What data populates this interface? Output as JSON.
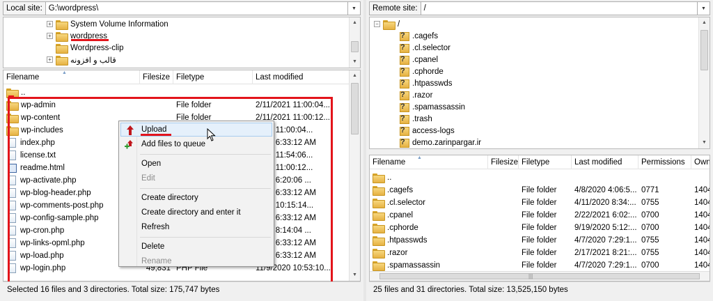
{
  "local": {
    "site_label": "Local site:",
    "site_path": "G:\\wordpress\\",
    "tree": [
      {
        "label": "System Volume Information"
      },
      {
        "label": "wordpress"
      },
      {
        "label": "Wordpress-clip"
      },
      {
        "label": "قالب و افزونه"
      }
    ],
    "columns": [
      "Filename",
      "Filesize",
      "Filetype",
      "Last modified"
    ],
    "files": [
      {
        "name": "..",
        "size": "",
        "type": "",
        "modified": "",
        "icon": "folder"
      },
      {
        "name": "wp-admin",
        "size": "",
        "type": "File folder",
        "modified": "2/11/2021 11:00:04...",
        "icon": "folder"
      },
      {
        "name": "wp-content",
        "size": "",
        "type": "File folder",
        "modified": "2/11/2021 11:00:12...",
        "icon": "folder"
      },
      {
        "name": "wp-includes",
        "size": "",
        "type": "",
        "modified": "2021 11:00:04...",
        "icon": "folder"
      },
      {
        "name": "index.php",
        "size": "",
        "type": "",
        "modified": "2020 6:33:12 AM",
        "icon": "file"
      },
      {
        "name": "license.txt",
        "size": "",
        "type": "",
        "modified": "2021 11:54:06...",
        "icon": "file"
      },
      {
        "name": "readme.html",
        "size": "",
        "type": "",
        "modified": "2021 11:00:12...",
        "icon": "html"
      },
      {
        "name": "wp-activate.php",
        "size": "",
        "type": "",
        "modified": "2020 6:20:06 ...",
        "icon": "file"
      },
      {
        "name": "wp-blog-header.php",
        "size": "",
        "type": "",
        "modified": "2020 6:33:12 AM",
        "icon": "file"
      },
      {
        "name": "wp-comments-post.php",
        "size": "",
        "type": "",
        "modified": "2020 10:15:14...",
        "icon": "file"
      },
      {
        "name": "wp-config-sample.php",
        "size": "",
        "type": "",
        "modified": "2020 6:33:12 AM",
        "icon": "file"
      },
      {
        "name": "wp-cron.php",
        "size": "",
        "type": "",
        "modified": "2020 8:14:04 ...",
        "icon": "file"
      },
      {
        "name": "wp-links-opml.php",
        "size": "",
        "type": "",
        "modified": "2020 6:33:12 AM",
        "icon": "file"
      },
      {
        "name": "wp-load.php",
        "size": "",
        "type": "",
        "modified": "2020 6:33:12 AM",
        "icon": "file"
      },
      {
        "name": "wp-login.php",
        "size": "49,831",
        "type": "PHP File",
        "modified": "11/9/2020 10:53:10...",
        "icon": "file"
      }
    ],
    "status": "Selected 16 files and 3 directories. Total size: 175,747 bytes"
  },
  "context_menu": {
    "items": [
      {
        "label": "Upload",
        "state": "hover",
        "icon": "upload-arrow-icon"
      },
      {
        "label": "Add files to queue",
        "state": "normal",
        "icon": "add-to-queue-icon"
      },
      {
        "sep": true
      },
      {
        "label": "Open",
        "state": "normal"
      },
      {
        "label": "Edit",
        "state": "disabled"
      },
      {
        "sep": true
      },
      {
        "label": "Create directory",
        "state": "normal"
      },
      {
        "label": "Create directory and enter it",
        "state": "normal"
      },
      {
        "label": "Refresh",
        "state": "normal"
      },
      {
        "sep": true
      },
      {
        "label": "Delete",
        "state": "normal"
      },
      {
        "label": "Rename",
        "state": "disabled"
      }
    ]
  },
  "remote": {
    "site_label": "Remote site:",
    "site_path": "/",
    "tree_root": "/",
    "tree": [
      {
        "label": ".cagefs"
      },
      {
        "label": ".cl.selector"
      },
      {
        "label": ".cpanel"
      },
      {
        "label": ".cphorde"
      },
      {
        "label": ".htpasswds"
      },
      {
        "label": ".razor"
      },
      {
        "label": ".spamassassin"
      },
      {
        "label": ".trash"
      },
      {
        "label": "access-logs"
      },
      {
        "label": "demo.zarinpargar.ir"
      }
    ],
    "columns": [
      "Filename",
      "Filesize",
      "Filetype",
      "Last modified",
      "Permissions",
      "Own"
    ],
    "files": [
      {
        "name": "..",
        "type": "",
        "modified": "",
        "perm": "",
        "owner": ""
      },
      {
        "name": ".cagefs",
        "type": "File folder",
        "modified": "4/8/2020 4:06:5...",
        "perm": "0771",
        "owner": "1404"
      },
      {
        "name": ".cl.selector",
        "type": "File folder",
        "modified": "4/11/2020 8:34:...",
        "perm": "0755",
        "owner": "1404"
      },
      {
        "name": ".cpanel",
        "type": "File folder",
        "modified": "2/22/2021 6:02:...",
        "perm": "0700",
        "owner": "1404"
      },
      {
        "name": ".cphorde",
        "type": "File folder",
        "modified": "9/19/2020 5:12:...",
        "perm": "0700",
        "owner": "1404"
      },
      {
        "name": ".htpasswds",
        "type": "File folder",
        "modified": "4/7/2020 7:29:1...",
        "perm": "0755",
        "owner": "1404"
      },
      {
        "name": ".razor",
        "type": "File folder",
        "modified": "2/17/2021 8:21:...",
        "perm": "0755",
        "owner": "1404"
      },
      {
        "name": ".spamassassin",
        "type": "File folder",
        "modified": "4/7/2020 7:29:1...",
        "perm": "0700",
        "owner": "1404"
      }
    ],
    "status": "25 files and 31 directories. Total size: 13,525,150 bytes"
  },
  "colors": {
    "highlight_red": "#e3141b",
    "menu_hover": "#e5f0fb"
  }
}
